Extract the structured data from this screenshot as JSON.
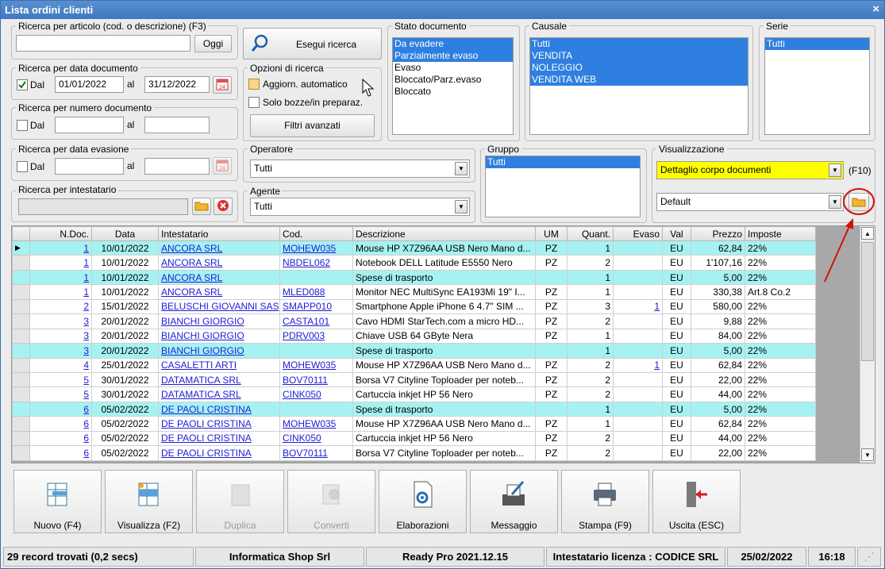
{
  "title": "Lista ordini clienti",
  "close": "×",
  "search_article": {
    "label": "Ricerca per articolo (cod. o descrizione) (F3)",
    "value": "",
    "today_btn": "Oggi"
  },
  "execute_btn": "Esegui ricerca",
  "search_date": {
    "label": "Ricerca per data documento",
    "dal": "Dal",
    "from": "01/01/2022",
    "al": "al",
    "to": "31/12/2022",
    "checked": true
  },
  "search_number": {
    "label": "Ricerca per numero documento",
    "dal": "Dal",
    "from": "",
    "al": "al",
    "to": ""
  },
  "options": {
    "label": "Opzioni di ricerca",
    "auto": "Aggiorn. automatico",
    "drafts": "Solo bozze/in preparaz.",
    "filters_btn": "Filtri avanzati"
  },
  "stato": {
    "label": "Stato documento",
    "items": [
      "Da evadere",
      "Parzialmente evaso",
      "Evaso",
      "Bloccato/Parz.evaso",
      "Bloccato"
    ],
    "selected": [
      0,
      1
    ]
  },
  "causale": {
    "label": "Causale",
    "items": [
      "Tutti",
      "VENDITA",
      "NOLEGGIO",
      "VENDITA WEB"
    ],
    "selected": [
      0,
      1,
      2,
      3
    ]
  },
  "serie": {
    "label": "Serie",
    "items": [
      "Tutti"
    ],
    "selected": [
      0
    ]
  },
  "search_evasion": {
    "label": "Ricerca per data evasione",
    "dal": "Dal",
    "from": "",
    "al": "al",
    "to": ""
  },
  "operatore": {
    "label": "Operatore",
    "value": "Tutti"
  },
  "agente": {
    "label": "Agente",
    "value": "Tutti"
  },
  "gruppo": {
    "label": "Gruppo",
    "items": [
      "Tutti"
    ],
    "selected": [
      0
    ]
  },
  "visualizzazione": {
    "label": "Visualizzazione",
    "value": "Dettaglio corpo documenti",
    "shortcut": "(F10)",
    "layout": "Default"
  },
  "intestatario": {
    "label": "Ricerca per intestatario",
    "value": ""
  },
  "table": {
    "headers": [
      "N.Doc.",
      "Data",
      "Intestatario",
      "Cod.",
      "Descrizione",
      "UM",
      "Quant.",
      "Evaso",
      "Val",
      "Prezzo",
      "Imposte"
    ],
    "rows": [
      [
        "1",
        "10/01/2022",
        "ANCORA SRL",
        "MOHEW035",
        "Mouse HP X7Z96AA USB Nero Mano d...",
        "PZ",
        "1",
        "",
        "EU",
        "62,84",
        "22%"
      ],
      [
        "1",
        "10/01/2022",
        "ANCORA SRL",
        "NBDEL062",
        "Notebook DELL Latitude E5550 Nero",
        "PZ",
        "2",
        "",
        "EU",
        "1'107,16",
        "22%"
      ],
      [
        "1",
        "10/01/2022",
        "ANCORA SRL",
        "",
        "Spese di trasporto",
        "",
        "1",
        "",
        "EU",
        "5,00",
        "22%"
      ],
      [
        "1",
        "10/01/2022",
        "ANCORA SRL",
        "MLED088",
        "Monitor NEC MultiSync EA193Mi 19\" I...",
        "PZ",
        "1",
        "",
        "EU",
        "330,38",
        "Art.8 Co.2"
      ],
      [
        "2",
        "15/01/2022",
        "BELUSCHI GIOVANNI SAS",
        "SMAPP010",
        "Smartphone Apple iPhone 6 4.7\" SIM ...",
        "PZ",
        "3",
        "1",
        "EU",
        "580,00",
        "22%"
      ],
      [
        "3",
        "20/01/2022",
        "BIANCHI GIORGIO",
        "CASTA101",
        "Cavo HDMI StarTech.com a micro HD...",
        "PZ",
        "2",
        "",
        "EU",
        "9,88",
        "22%"
      ],
      [
        "3",
        "20/01/2022",
        "BIANCHI GIORGIO",
        "PDRV003",
        "Chiave USB 64 GByte Nera",
        "PZ",
        "1",
        "",
        "EU",
        "84,00",
        "22%"
      ],
      [
        "3",
        "20/01/2022",
        "BIANCHI GIORGIO",
        "",
        "Spese di trasporto",
        "",
        "1",
        "",
        "EU",
        "5,00",
        "22%"
      ],
      [
        "4",
        "25/01/2022",
        "CASALETTI ARTI",
        "MOHEW035",
        "Mouse HP X7Z96AA USB Nero Mano d...",
        "PZ",
        "2",
        "1",
        "EU",
        "62,84",
        "22%"
      ],
      [
        "5",
        "30/01/2022",
        "DATAMATICA SRL",
        "BOV70111",
        "Borsa V7 Cityline Toploader per noteb...",
        "PZ",
        "2",
        "",
        "EU",
        "22,00",
        "22%"
      ],
      [
        "5",
        "30/01/2022",
        "DATAMATICA SRL",
        "CINK050",
        "Cartuccia inkjet HP 56 Nero",
        "PZ",
        "2",
        "",
        "EU",
        "44,00",
        "22%"
      ],
      [
        "6",
        "05/02/2022",
        "DE PAOLI CRISTINA",
        "",
        "Spese di trasporto",
        "",
        "1",
        "",
        "EU",
        "5,00",
        "22%"
      ],
      [
        "6",
        "05/02/2022",
        "DE PAOLI CRISTINA",
        "MOHEW035",
        "Mouse HP X7Z96AA USB Nero Mano d...",
        "PZ",
        "1",
        "",
        "EU",
        "62,84",
        "22%"
      ],
      [
        "6",
        "05/02/2022",
        "DE PAOLI CRISTINA",
        "CINK050",
        "Cartuccia inkjet HP 56 Nero",
        "PZ",
        "2",
        "",
        "EU",
        "44,00",
        "22%"
      ],
      [
        "6",
        "05/02/2022",
        "DE PAOLI CRISTINA",
        "BOV70111",
        "Borsa V7 Cityline Toploader per noteb...",
        "PZ",
        "2",
        "",
        "EU",
        "22,00",
        "22%"
      ]
    ],
    "highlight_rows": [
      0,
      2,
      7,
      11
    ]
  },
  "toolbar": [
    {
      "label": "Nuovo (F4)",
      "icon": "new-document-icon",
      "enabled": true
    },
    {
      "label": "Visualizza (F2)",
      "icon": "view-grid-icon",
      "enabled": true
    },
    {
      "label": "Duplica",
      "icon": "duplicate-icon",
      "enabled": false
    },
    {
      "label": "Converti",
      "icon": "convert-icon",
      "enabled": false
    },
    {
      "label": "Elaborazioni",
      "icon": "gear-document-icon",
      "enabled": true
    },
    {
      "label": "Messaggio",
      "icon": "message-tray-icon",
      "enabled": true
    },
    {
      "label": "Stampa (F9)",
      "icon": "printer-icon",
      "enabled": true
    },
    {
      "label": "Uscita (ESC)",
      "icon": "exit-door-icon",
      "enabled": true
    }
  ],
  "status": {
    "records": "29 record trovati (0,2 secs)",
    "company": "Informatica Shop Srl",
    "version": "Ready Pro 2021.12.15",
    "license": "Intestatario licenza : CODICE SRL",
    "date": "25/02/2022",
    "time": "16:18"
  },
  "colors": {
    "accent": "#2f7fe0",
    "highlight_row": "#a6f2f2",
    "visualizzazione_bg": "#ffff00",
    "annotation": "#d01010"
  }
}
